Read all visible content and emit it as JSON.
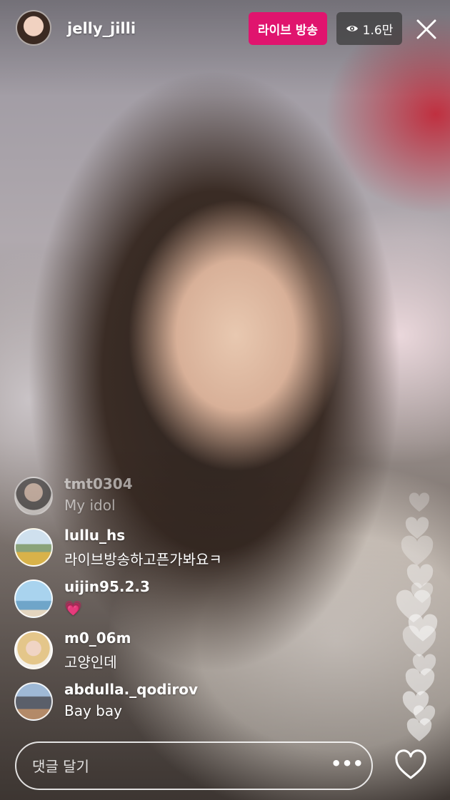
{
  "header": {
    "username": "jelly_jilli",
    "live_label": "라이브 방송",
    "viewer_count": "1.6만",
    "live_color": "#e0146e"
  },
  "comments": [
    {
      "username": "tmt0304",
      "text": "My idol"
    },
    {
      "username": "lullu_hs",
      "text": "라이브방송하고픈가봐요ㅋ"
    },
    {
      "username": "uijin95.2.3",
      "text": "💗"
    },
    {
      "username": "m0_06m",
      "text": "고양인데"
    },
    {
      "username": "abdulla._qodirov",
      "text": "Bay bay"
    }
  ],
  "footer": {
    "comment_placeholder": "댓글 달기",
    "more_label": "•••"
  },
  "icons": [
    "eye-icon",
    "close-icon",
    "heart-icon",
    "floating-heart-icon"
  ]
}
